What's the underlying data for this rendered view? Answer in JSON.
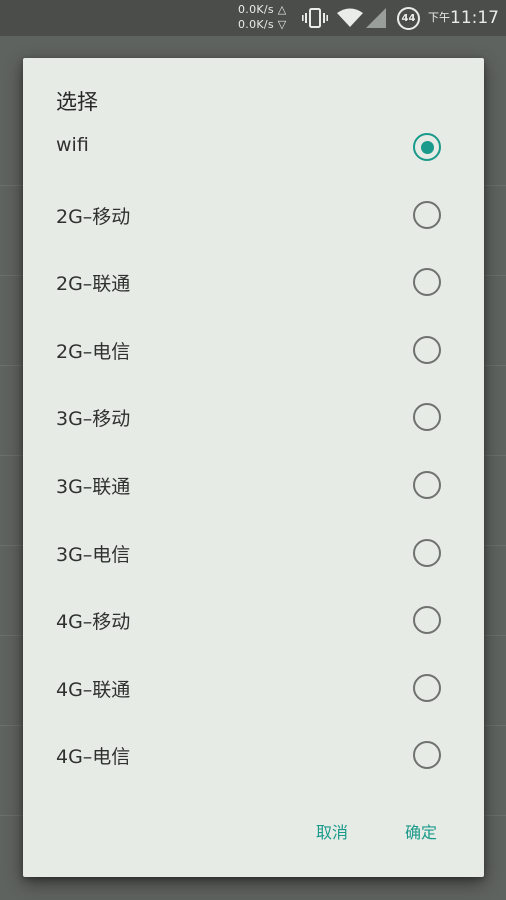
{
  "status_bar": {
    "upload_speed": "0.0K/s △",
    "download_speed": "0.0K/s ▽",
    "battery_level": "44",
    "time_ampm": "下午",
    "time": "11:17"
  },
  "dialog": {
    "title": "选择",
    "options": [
      {
        "label": "wifi",
        "checked": true
      },
      {
        "label": "2G–移动",
        "checked": false
      },
      {
        "label": "2G–联通",
        "checked": false
      },
      {
        "label": "2G–电信",
        "checked": false
      },
      {
        "label": "3G–移动",
        "checked": false
      },
      {
        "label": "3G–联通",
        "checked": false
      },
      {
        "label": "3G–电信",
        "checked": false
      },
      {
        "label": "4G–移动",
        "checked": false
      },
      {
        "label": "4G–联通",
        "checked": false
      },
      {
        "label": "4G–电信",
        "checked": false
      }
    ],
    "cancel_label": "取消",
    "ok_label": "确定"
  },
  "colors": {
    "accent": "#1a9a8a",
    "dialog_bg": "#e6ebe6",
    "scrim": "#5f635f"
  }
}
